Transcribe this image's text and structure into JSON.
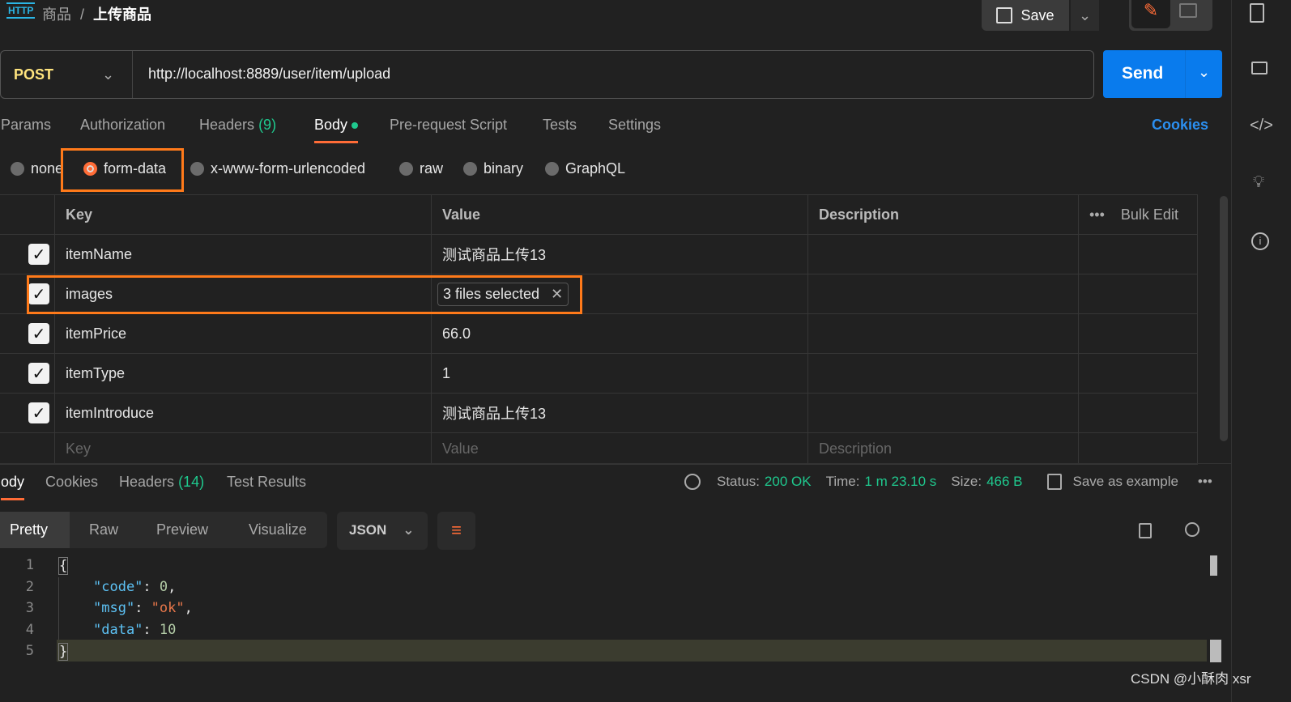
{
  "header": {
    "icon": "http-icon",
    "breadcrumb_parent": "商品",
    "separator": "/",
    "title": "上传商品",
    "save_label": "Save"
  },
  "request": {
    "method": "POST",
    "url": "http://localhost:8889/user/item/upload",
    "send_label": "Send"
  },
  "tabs": [
    {
      "label": "Params"
    },
    {
      "label": "Authorization"
    },
    {
      "label": "Headers",
      "count": "(9)"
    },
    {
      "label": "Body"
    },
    {
      "label": "Pre-request Script"
    },
    {
      "label": "Tests"
    },
    {
      "label": "Settings"
    }
  ],
  "cookies_label": "Cookies",
  "body_types": [
    "none",
    "form-data",
    "x-www-form-urlencoded",
    "raw",
    "binary",
    "GraphQL"
  ],
  "selected_body_type": "form-data",
  "table": {
    "headers": {
      "key": "Key",
      "value": "Value",
      "description": "Description",
      "bulk_edit": "Bulk Edit"
    },
    "rows": [
      {
        "key": "itemName",
        "value": "测试商品上传13"
      },
      {
        "key": "images",
        "value": "3 files selected"
      },
      {
        "key": "itemPrice",
        "value": "66.0"
      },
      {
        "key": "itemType",
        "value": "1"
      },
      {
        "key": "itemIntroduce",
        "value": "测试商品上传13"
      }
    ],
    "placeholder": {
      "key": "Key",
      "value": "Value",
      "description": "Description"
    }
  },
  "response": {
    "tabs": [
      {
        "label": "ody"
      },
      {
        "label": "Cookies"
      },
      {
        "label": "Headers",
        "count": "(14)"
      },
      {
        "label": "Test Results"
      }
    ],
    "status_label": "Status:",
    "status": "200 OK",
    "time_label": "Time:",
    "time": "1 m 23.10 s",
    "size_label": "Size:",
    "size": "466 B",
    "save_example": "Save as example",
    "views": [
      "Pretty",
      "Raw",
      "Preview",
      "Visualize"
    ],
    "format": "JSON",
    "lines": [
      "1",
      "2",
      "3",
      "4",
      "5"
    ]
  },
  "colors": {
    "accent": "#ff6c37",
    "send": "#097bed",
    "green": "#1fc98e",
    "method": "#ffe47e"
  },
  "watermark": "CSDN @小酥肉 xsr"
}
